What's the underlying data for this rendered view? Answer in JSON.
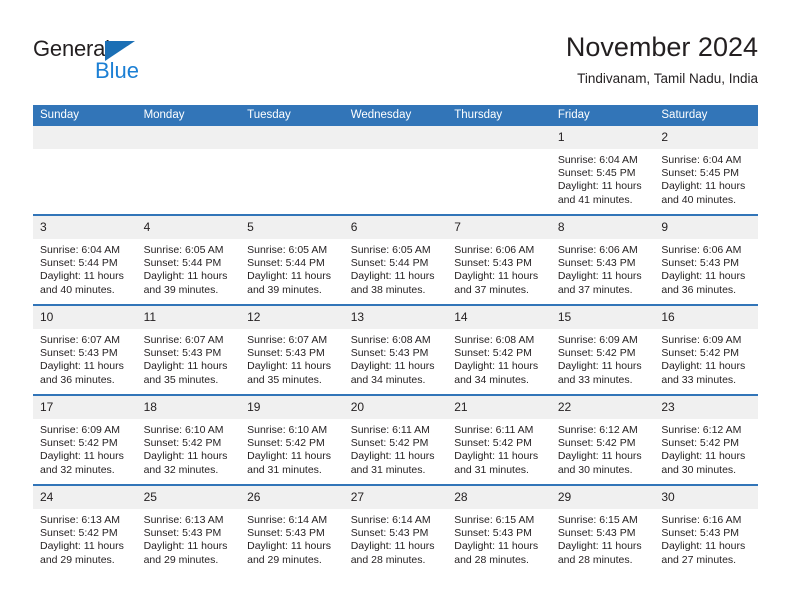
{
  "brand": {
    "name_part1": "General",
    "name_part2": "Blue",
    "triangle_color": "#1b6fb5",
    "blue_color": "#1b7fd4"
  },
  "header": {
    "title": "November 2024",
    "subtitle": "Tindivanam, Tamil Nadu, India"
  },
  "theme": {
    "header_bg": "#3275b8",
    "daynum_bg": "#f0f0f0",
    "row_border": "#3275b8",
    "text": "#231f20"
  },
  "weekday_headers": [
    "Sunday",
    "Monday",
    "Tuesday",
    "Wednesday",
    "Thursday",
    "Friday",
    "Saturday"
  ],
  "labels": {
    "sunrise_prefix": "Sunrise: ",
    "sunset_prefix": "Sunset: ",
    "daylight_prefix": "Daylight: "
  },
  "weeks": [
    [
      {
        "day": "",
        "sunrise": "",
        "sunset": "",
        "daylight_line1": "",
        "daylight_line2": ""
      },
      {
        "day": "",
        "sunrise": "",
        "sunset": "",
        "daylight_line1": "",
        "daylight_line2": ""
      },
      {
        "day": "",
        "sunrise": "",
        "sunset": "",
        "daylight_line1": "",
        "daylight_line2": ""
      },
      {
        "day": "",
        "sunrise": "",
        "sunset": "",
        "daylight_line1": "",
        "daylight_line2": ""
      },
      {
        "day": "",
        "sunrise": "",
        "sunset": "",
        "daylight_line1": "",
        "daylight_line2": ""
      },
      {
        "day": "1",
        "sunrise": "Sunrise: 6:04 AM",
        "sunset": "Sunset: 5:45 PM",
        "daylight_line1": "Daylight: 11 hours",
        "daylight_line2": "and 41 minutes."
      },
      {
        "day": "2",
        "sunrise": "Sunrise: 6:04 AM",
        "sunset": "Sunset: 5:45 PM",
        "daylight_line1": "Daylight: 11 hours",
        "daylight_line2": "and 40 minutes."
      }
    ],
    [
      {
        "day": "3",
        "sunrise": "Sunrise: 6:04 AM",
        "sunset": "Sunset: 5:44 PM",
        "daylight_line1": "Daylight: 11 hours",
        "daylight_line2": "and 40 minutes."
      },
      {
        "day": "4",
        "sunrise": "Sunrise: 6:05 AM",
        "sunset": "Sunset: 5:44 PM",
        "daylight_line1": "Daylight: 11 hours",
        "daylight_line2": "and 39 minutes."
      },
      {
        "day": "5",
        "sunrise": "Sunrise: 6:05 AM",
        "sunset": "Sunset: 5:44 PM",
        "daylight_line1": "Daylight: 11 hours",
        "daylight_line2": "and 39 minutes."
      },
      {
        "day": "6",
        "sunrise": "Sunrise: 6:05 AM",
        "sunset": "Sunset: 5:44 PM",
        "daylight_line1": "Daylight: 11 hours",
        "daylight_line2": "and 38 minutes."
      },
      {
        "day": "7",
        "sunrise": "Sunrise: 6:06 AM",
        "sunset": "Sunset: 5:43 PM",
        "daylight_line1": "Daylight: 11 hours",
        "daylight_line2": "and 37 minutes."
      },
      {
        "day": "8",
        "sunrise": "Sunrise: 6:06 AM",
        "sunset": "Sunset: 5:43 PM",
        "daylight_line1": "Daylight: 11 hours",
        "daylight_line2": "and 37 minutes."
      },
      {
        "day": "9",
        "sunrise": "Sunrise: 6:06 AM",
        "sunset": "Sunset: 5:43 PM",
        "daylight_line1": "Daylight: 11 hours",
        "daylight_line2": "and 36 minutes."
      }
    ],
    [
      {
        "day": "10",
        "sunrise": "Sunrise: 6:07 AM",
        "sunset": "Sunset: 5:43 PM",
        "daylight_line1": "Daylight: 11 hours",
        "daylight_line2": "and 36 minutes."
      },
      {
        "day": "11",
        "sunrise": "Sunrise: 6:07 AM",
        "sunset": "Sunset: 5:43 PM",
        "daylight_line1": "Daylight: 11 hours",
        "daylight_line2": "and 35 minutes."
      },
      {
        "day": "12",
        "sunrise": "Sunrise: 6:07 AM",
        "sunset": "Sunset: 5:43 PM",
        "daylight_line1": "Daylight: 11 hours",
        "daylight_line2": "and 35 minutes."
      },
      {
        "day": "13",
        "sunrise": "Sunrise: 6:08 AM",
        "sunset": "Sunset: 5:43 PM",
        "daylight_line1": "Daylight: 11 hours",
        "daylight_line2": "and 34 minutes."
      },
      {
        "day": "14",
        "sunrise": "Sunrise: 6:08 AM",
        "sunset": "Sunset: 5:42 PM",
        "daylight_line1": "Daylight: 11 hours",
        "daylight_line2": "and 34 minutes."
      },
      {
        "day": "15",
        "sunrise": "Sunrise: 6:09 AM",
        "sunset": "Sunset: 5:42 PM",
        "daylight_line1": "Daylight: 11 hours",
        "daylight_line2": "and 33 minutes."
      },
      {
        "day": "16",
        "sunrise": "Sunrise: 6:09 AM",
        "sunset": "Sunset: 5:42 PM",
        "daylight_line1": "Daylight: 11 hours",
        "daylight_line2": "and 33 minutes."
      }
    ],
    [
      {
        "day": "17",
        "sunrise": "Sunrise: 6:09 AM",
        "sunset": "Sunset: 5:42 PM",
        "daylight_line1": "Daylight: 11 hours",
        "daylight_line2": "and 32 minutes."
      },
      {
        "day": "18",
        "sunrise": "Sunrise: 6:10 AM",
        "sunset": "Sunset: 5:42 PM",
        "daylight_line1": "Daylight: 11 hours",
        "daylight_line2": "and 32 minutes."
      },
      {
        "day": "19",
        "sunrise": "Sunrise: 6:10 AM",
        "sunset": "Sunset: 5:42 PM",
        "daylight_line1": "Daylight: 11 hours",
        "daylight_line2": "and 31 minutes."
      },
      {
        "day": "20",
        "sunrise": "Sunrise: 6:11 AM",
        "sunset": "Sunset: 5:42 PM",
        "daylight_line1": "Daylight: 11 hours",
        "daylight_line2": "and 31 minutes."
      },
      {
        "day": "21",
        "sunrise": "Sunrise: 6:11 AM",
        "sunset": "Sunset: 5:42 PM",
        "daylight_line1": "Daylight: 11 hours",
        "daylight_line2": "and 31 minutes."
      },
      {
        "day": "22",
        "sunrise": "Sunrise: 6:12 AM",
        "sunset": "Sunset: 5:42 PM",
        "daylight_line1": "Daylight: 11 hours",
        "daylight_line2": "and 30 minutes."
      },
      {
        "day": "23",
        "sunrise": "Sunrise: 6:12 AM",
        "sunset": "Sunset: 5:42 PM",
        "daylight_line1": "Daylight: 11 hours",
        "daylight_line2": "and 30 minutes."
      }
    ],
    [
      {
        "day": "24",
        "sunrise": "Sunrise: 6:13 AM",
        "sunset": "Sunset: 5:42 PM",
        "daylight_line1": "Daylight: 11 hours",
        "daylight_line2": "and 29 minutes."
      },
      {
        "day": "25",
        "sunrise": "Sunrise: 6:13 AM",
        "sunset": "Sunset: 5:43 PM",
        "daylight_line1": "Daylight: 11 hours",
        "daylight_line2": "and 29 minutes."
      },
      {
        "day": "26",
        "sunrise": "Sunrise: 6:14 AM",
        "sunset": "Sunset: 5:43 PM",
        "daylight_line1": "Daylight: 11 hours",
        "daylight_line2": "and 29 minutes."
      },
      {
        "day": "27",
        "sunrise": "Sunrise: 6:14 AM",
        "sunset": "Sunset: 5:43 PM",
        "daylight_line1": "Daylight: 11 hours",
        "daylight_line2": "and 28 minutes."
      },
      {
        "day": "28",
        "sunrise": "Sunrise: 6:15 AM",
        "sunset": "Sunset: 5:43 PM",
        "daylight_line1": "Daylight: 11 hours",
        "daylight_line2": "and 28 minutes."
      },
      {
        "day": "29",
        "sunrise": "Sunrise: 6:15 AM",
        "sunset": "Sunset: 5:43 PM",
        "daylight_line1": "Daylight: 11 hours",
        "daylight_line2": "and 28 minutes."
      },
      {
        "day": "30",
        "sunrise": "Sunrise: 6:16 AM",
        "sunset": "Sunset: 5:43 PM",
        "daylight_line1": "Daylight: 11 hours",
        "daylight_line2": "and 27 minutes."
      }
    ]
  ]
}
